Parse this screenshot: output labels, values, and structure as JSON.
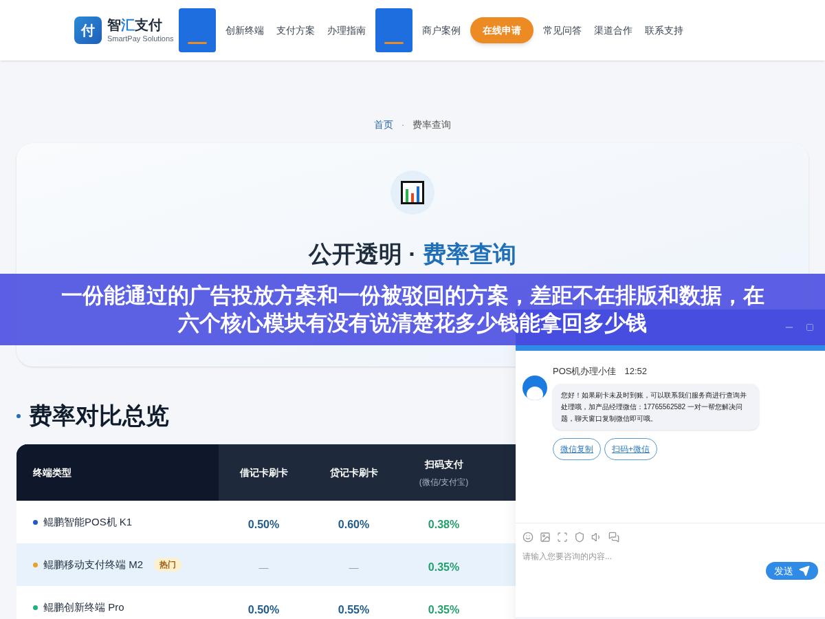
{
  "brand": {
    "logo_char": "付",
    "name_parts": [
      "智",
      "汇",
      "支付"
    ],
    "subtitle": "SmartPay Solutions"
  },
  "nav": [
    {
      "selected": true
    },
    {
      "label": "创新终端",
      "selected": false
    },
    {
      "label": "支付方案",
      "selected": false
    },
    {
      "label": "办理指南",
      "selected": false
    },
    {
      "selected": true
    },
    {
      "label": "商户案例",
      "selected": false
    },
    {
      "label": "在线申请",
      "kind": "cta",
      "selected": false
    },
    {
      "label": "常见问答",
      "selected": false
    },
    {
      "label": "渠道合作",
      "selected": false
    },
    {
      "label": "联系支持",
      "selected": false
    }
  ],
  "breadcrumb": [
    "首页",
    "·",
    "费率查询"
  ],
  "hero": {
    "title_plain": "公开透明 · ",
    "title_accent": "费率查询"
  },
  "section_title": "费率对比总览",
  "table": {
    "columns": [
      {
        "label": "终端类型"
      },
      {
        "label": "借记卡刷卡"
      },
      {
        "label": "贷记卡刷卡"
      },
      {
        "label": "扫码支付",
        "sub": "(微信/支付宝)"
      }
    ],
    "rows": [
      {
        "color": "#2557c7",
        "selected": false,
        "cells": [
          "鲲鹏智能POS机 K1",
          "0.50%",
          "0.60%",
          "0.38%"
        ]
      },
      {
        "color": "#e8a12a",
        "badge": "热门",
        "selected": true,
        "cells": [
          "鲲鹏移动支付终端 M2",
          "—",
          "—",
          "0.35%"
        ]
      },
      {
        "color": "#22b07d",
        "selected": false,
        "cells": [
          "鲲鹏创新终端 Pro",
          "0.50%",
          "0.55%",
          "0.35%"
        ]
      }
    ]
  },
  "banner": {
    "lines": [
      "一份能通过的广告投放方案和一份被驳回的方案，差距不在排版和数据，在",
      "六个核心模块有没有说清楚花多少钱能拿回多少钱"
    ]
  },
  "chat": {
    "agent": "POS机办理小佳",
    "time": "12:52",
    "message": "您好！如果刷卡未及时到账，可以联系我们服务商进行查询并处理哦，加产品经理微信：17765562582 一对一帮您解决问题，聊天窗口复制微信即可哦。",
    "actions": [
      "微信复制",
      "扫码+微信"
    ],
    "placeholder": "请输入您要咨询的内容...",
    "send": "发送"
  }
}
